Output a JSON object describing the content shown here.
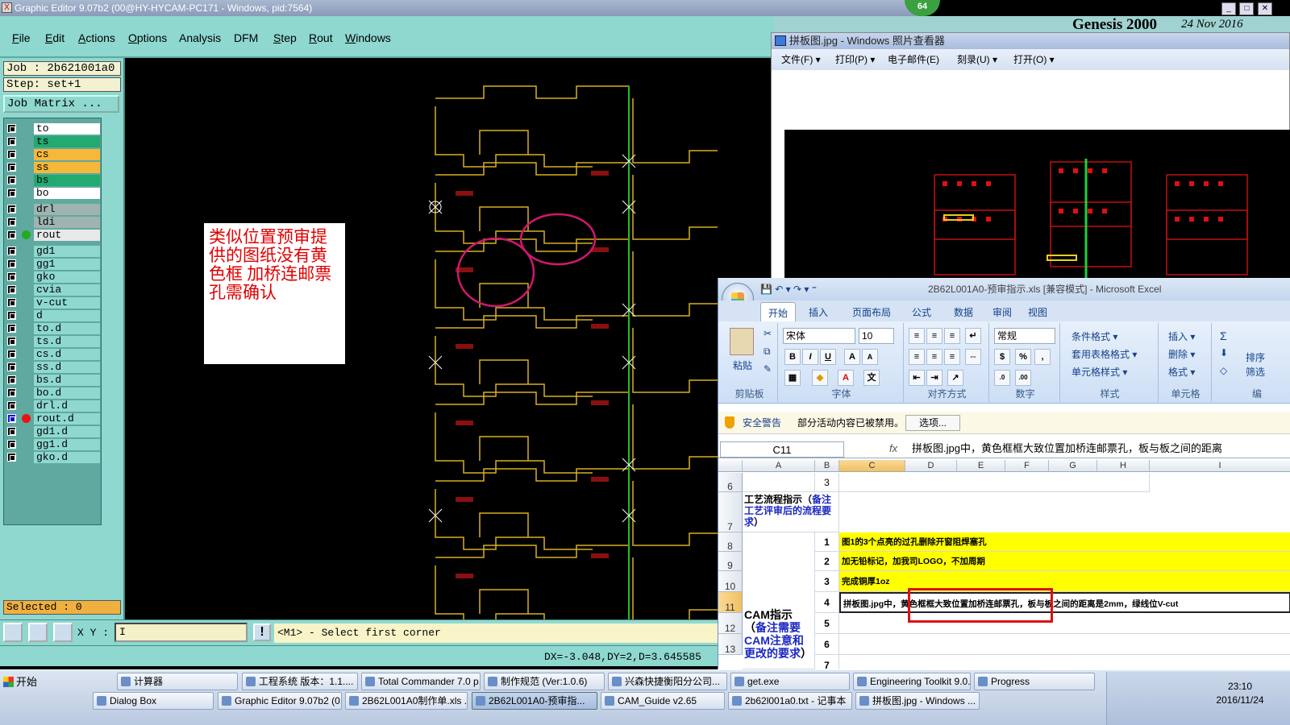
{
  "app": {
    "title": "Graphic Editor 9.07b2 (00@HY-HYCAM-PC171 - Windows, pid:7564)",
    "icon_letter": "X"
  },
  "menu": [
    {
      "u": "F",
      "rest": "ile"
    },
    {
      "u": "E",
      "rest": "dit"
    },
    {
      "u": "A",
      "rest": "ctions"
    },
    {
      "u": "O",
      "rest": "ptions"
    },
    {
      "u": "",
      "rest": "Analysis"
    },
    {
      "u": "",
      "rest": "DFM"
    },
    {
      "u": "S",
      "rest": "tep"
    },
    {
      "u": "R",
      "rest": "out"
    },
    {
      "u": "W",
      "rest": "indows"
    }
  ],
  "job": {
    "job_label": "Job : 2b621001a0",
    "step_label": "Step: set+1",
    "matrix_button": "Job Matrix ..."
  },
  "layers": [
    {
      "name": "to",
      "bg": "#ffffff",
      "dot": ""
    },
    {
      "name": "ts",
      "bg": "#22aa70",
      "dot": ""
    },
    {
      "name": "cs",
      "bg": "#f5b83a",
      "dot": ""
    },
    {
      "name": "ss",
      "bg": "#f5b83a",
      "dot": ""
    },
    {
      "name": "bs",
      "bg": "#22aa70",
      "dot": ""
    },
    {
      "name": "bo",
      "bg": "#ffffff",
      "dot": ""
    },
    {
      "name": "drl",
      "bg": "#9fb4b0",
      "dot": ""
    },
    {
      "name": "ldi",
      "bg": "#9fb4b0",
      "dot": ""
    },
    {
      "name": "rout",
      "bg": "#e8e8e8",
      "dot": "#22aa22"
    },
    {
      "name": "gd1",
      "bg": "#8ed8d0",
      "dot": ""
    },
    {
      "name": "gg1",
      "bg": "#8ed8d0",
      "dot": ""
    },
    {
      "name": "gko",
      "bg": "#8ed8d0",
      "dot": ""
    },
    {
      "name": "cvia",
      "bg": "#8ed8d0",
      "dot": ""
    },
    {
      "name": "v-cut",
      "bg": "#8ed8d0",
      "dot": ""
    },
    {
      "name": "d",
      "bg": "#8ed8d0",
      "dot": ""
    },
    {
      "name": "to.d",
      "bg": "#8ed8d0",
      "dot": ""
    },
    {
      "name": "ts.d",
      "bg": "#8ed8d0",
      "dot": ""
    },
    {
      "name": "cs.d",
      "bg": "#8ed8d0",
      "dot": ""
    },
    {
      "name": "ss.d",
      "bg": "#8ed8d0",
      "dot": ""
    },
    {
      "name": "bs.d",
      "bg": "#8ed8d0",
      "dot": ""
    },
    {
      "name": "bo.d",
      "bg": "#8ed8d0",
      "dot": ""
    },
    {
      "name": "drl.d",
      "bg": "#8ed8d0",
      "dot": ""
    },
    {
      "name": "rout.d",
      "bg": "#8ed8d0",
      "dot": "#ee1111"
    },
    {
      "name": "gd1.d",
      "bg": "#8ed8d0",
      "dot": ""
    },
    {
      "name": "gg1.d",
      "bg": "#8ed8d0",
      "dot": ""
    },
    {
      "name": "gko.d",
      "bg": "#8ed8d0",
      "dot": ""
    }
  ],
  "selected_label": "Selected : 0",
  "note_text": "类似位置预审提供的图纸没有黄色框  加桥连邮票孔需确认",
  "bottom": {
    "xy_label": "X Y :",
    "xy_value": "I",
    "excl": "!",
    "prompt": "<M1> - Select first corner"
  },
  "status": {
    "dxdy": "DX=-3.048,DY=2,D=3.645585"
  },
  "topright": {
    "badge": "64",
    "genesis": "Genesis 2000",
    "date": "24 Nov 2016"
  },
  "photo_viewer": {
    "title": "拼板图.jpg - Windows 照片查看器",
    "toolbar": [
      "文件(F) ▾",
      "打印(P) ▾",
      "电子邮件(E)",
      "刻录(U) ▾",
      "打开(O) ▾"
    ]
  },
  "excel": {
    "title": "2B62L001A0-预审指示.xls  [兼容模式] - Microsoft Excel",
    "tabs": [
      "开始",
      "插入",
      "页面布局",
      "公式",
      "数据",
      "审阅",
      "视图"
    ],
    "ribbon": {
      "paste": "粘贴",
      "font": "宋体",
      "size": "10",
      "number_format": "常规",
      "groups": [
        "剪贴板",
        "字体",
        "对齐方式",
        "数字",
        "样式",
        "单元格",
        "编"
      ],
      "styles": [
        "条件格式 ▾",
        "套用表格格式 ▾",
        "单元格样式 ▾"
      ],
      "cells": [
        "插入 ▾",
        "删除 ▾",
        "格式 ▾"
      ],
      "sort": [
        "排序",
        "筛选"
      ]
    },
    "security": {
      "label": "安全警告",
      "message": "部分活动内容已被禁用。",
      "options": "选项..."
    },
    "namebox": "C11",
    "fx": "fx",
    "formula": "拼板图.jpg中，黄色框框大致位置加桥连邮票孔，板与板之间的距离",
    "col_headers": [
      "A",
      "B",
      "C",
      "D",
      "E",
      "F",
      "G",
      "H",
      "I"
    ],
    "row_headers": [
      "6",
      "7",
      "8",
      "9",
      "10",
      "11",
      "12",
      "13"
    ],
    "b6": "3",
    "a7": "工艺流程指示（备注工艺评审后的流程要求）",
    "a7_black": "工艺流程指示（",
    "a7_blue": "备注工艺评审后的流程要求",
    "a7_end": "）",
    "cam_black": "CAM指示（",
    "cam_blue": "备注需要CAM注意和更改的要求",
    "cam_end": "）",
    "rows": [
      {
        "num": "1",
        "text": "图1的3个点亮的过孔删除开窗阻焊塞孔",
        "yellow": true
      },
      {
        "num": "2",
        "text": "加无铅标记，加我司LOGO，不加周期",
        "yellow": true
      },
      {
        "num": "3",
        "text": "完成铜厚1oz",
        "yellow": true
      },
      {
        "num": "4",
        "text": "拼板图.jpg中，黄色框框大致位置加桥连邮票孔，板与板之间的距离是2mm，绿线位V-cut",
        "yellow": false
      },
      {
        "num": "5",
        "text": "",
        "yellow": false
      },
      {
        "num": "6",
        "text": "",
        "yellow": false
      },
      {
        "num": "7",
        "text": "",
        "yellow": false
      }
    ]
  },
  "taskbar": {
    "start": "开始",
    "row1": [
      "计算器",
      "工程系统  版本：1.1....",
      "Total Commander 7.0 p...",
      "制作规范 (Ver:1.0.6)",
      "兴森快捷衡阳分公司...",
      "get.exe",
      "Engineering Toolkit 9.0...",
      "Progress"
    ],
    "row2": [
      "Dialog Box",
      "Graphic Editor 9.07b2 (0...",
      "2B62L001A0制作单.xls ...",
      "2B62L001A0-预审指...",
      "CAM_Guide v2.65",
      "2b62l001a0.txt - 记事本",
      "拼板图.jpg - Windows ..."
    ],
    "time": "23:10",
    "date": "2016/11/24"
  }
}
